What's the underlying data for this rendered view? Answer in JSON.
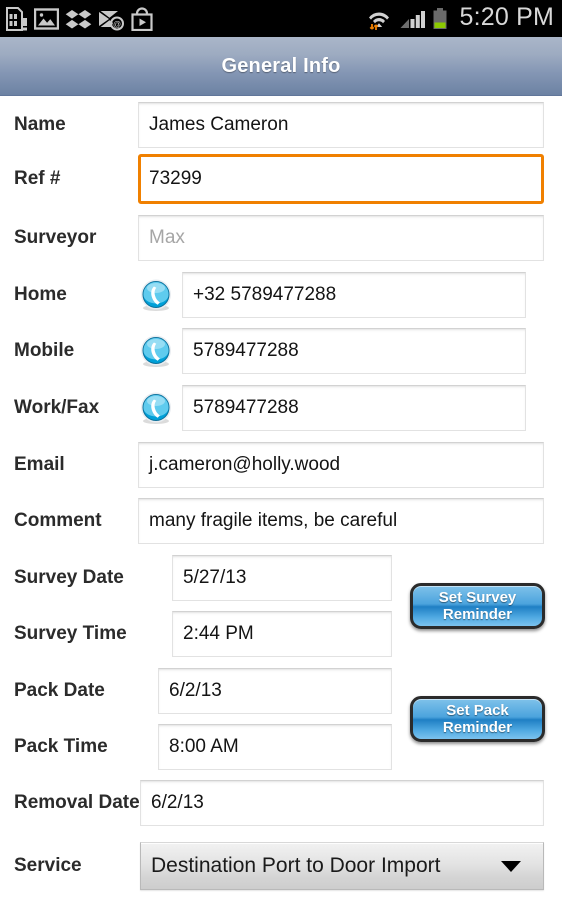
{
  "statusbar": {
    "icons": [
      "sdcard-warning-icon",
      "gallery-icon",
      "dropbox-icon",
      "email-icon",
      "play-store-icon"
    ],
    "right_icons": [
      "wifi-icon",
      "signal-icon",
      "battery-icon"
    ],
    "clock": "5:20 PM"
  },
  "titlebar": {
    "title": "General Info"
  },
  "form": {
    "fields": [
      {
        "label": "Name",
        "value": "James Cameron"
      },
      {
        "label": "Ref #",
        "value": "73299"
      },
      {
        "label": "Surveyor",
        "value": "",
        "placeholder": "Max"
      },
      {
        "label": "Home",
        "value": "+32 5789477288",
        "icon": "phone-call-icon"
      },
      {
        "label": "Mobile",
        "value": "5789477288",
        "icon": "phone-call-icon"
      },
      {
        "label": "Work/Fax",
        "value": "5789477288",
        "icon": "phone-call-icon"
      },
      {
        "label": "Email",
        "value": "j.cameron@holly.wood"
      },
      {
        "label": "Comment",
        "value": "many fragile items, be careful"
      },
      {
        "label": "Survey Date",
        "value": "5/27/13"
      },
      {
        "label": "Survey Time",
        "value": "2:44 PM"
      },
      {
        "label": "Pack Date",
        "value": "6/2/13"
      },
      {
        "label": "Pack Time",
        "value": "8:00 AM"
      },
      {
        "label": "Removal Date",
        "value": "6/2/13"
      },
      {
        "label": "Service",
        "value": "Destination Port to Door Import"
      }
    ],
    "buttons": {
      "survey_reminder_line1": "Set Survey",
      "survey_reminder_line2": "Reminder",
      "pack_reminder_line1": "Set Pack",
      "pack_reminder_line2": "Reminder"
    }
  },
  "colors": {
    "focus_orange": "#f08000",
    "titlebar_top": "#aab6c9",
    "titlebar_bottom": "#6c82a3",
    "button_blue": "#2f8fd0",
    "battery_green": "#8bc900"
  }
}
